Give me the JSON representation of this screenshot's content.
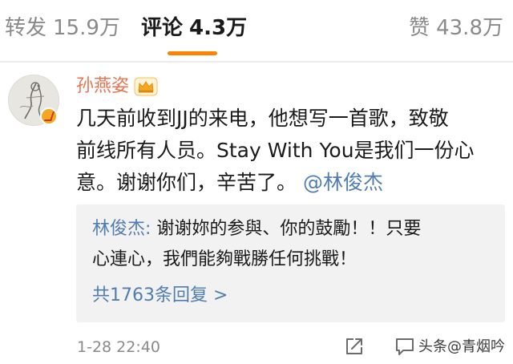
{
  "tabs": {
    "repost_label": "转发",
    "repost_count": "15.9万",
    "comments_label": "评论",
    "comments_count": "4.3万",
    "likes_label": "赞",
    "likes_count": "43.8万",
    "active": "comments",
    "accent_color": "#ff8200"
  },
  "comment": {
    "author": "孙燕姿",
    "author_badge": "crown-icon",
    "verified_badge": "verified-v-icon",
    "text_lines": [
      "几天前收到JJ的来电，他想写一首歌，致敬",
      "前线所有人员。Stay With You是我们一份心",
      "意。谢谢你们，辛苦了。"
    ],
    "mention": "@林俊杰",
    "name_color": "#eb7350",
    "link_color": "#507daf"
  },
  "reply": {
    "author": "林俊杰:",
    "line1": "谢谢妳的参與、你的鼓勵！！只要",
    "line2": "心連心，我們能夠戰勝任何挑戰！",
    "more_link": "共1763条回复 >"
  },
  "footer": {
    "timestamp": "1-28 22:40",
    "share_icon": "share-icon",
    "comment_icon": "comment-icon",
    "watermark": "头条@青烟吟"
  }
}
